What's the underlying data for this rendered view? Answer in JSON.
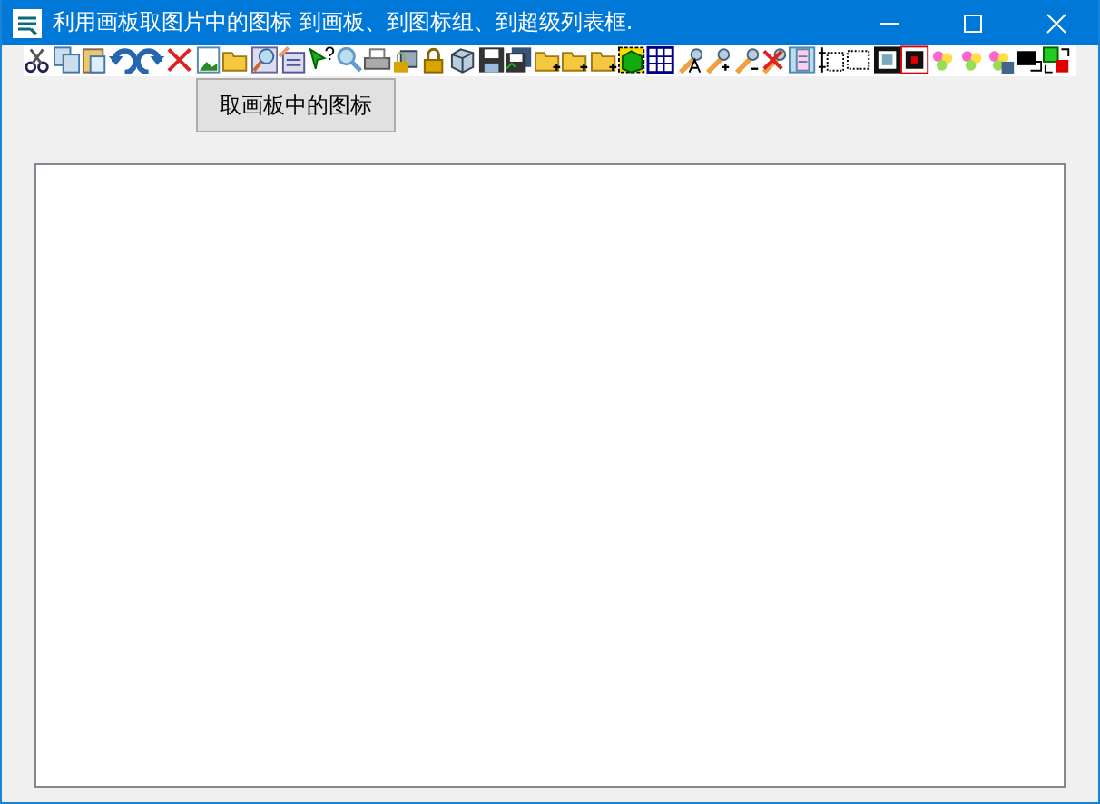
{
  "window": {
    "title": "利用画板取图片中的图标 到画板、到图标组、到超级列表框."
  },
  "button": {
    "label": "取画板中的图标"
  }
}
